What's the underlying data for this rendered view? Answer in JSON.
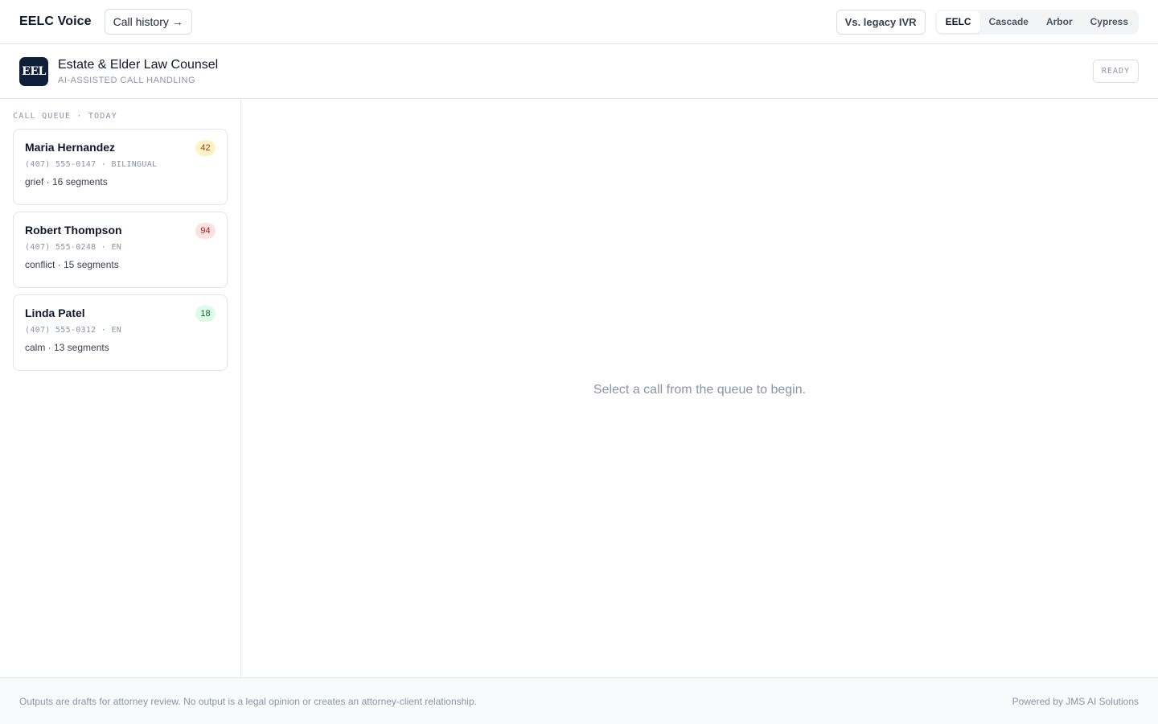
{
  "topbar": {
    "brand": "EELC Voice",
    "history_label": "Call history →",
    "legacy_label": "Vs. legacy IVR",
    "tenants": [
      {
        "label": "EELC",
        "active": true
      },
      {
        "label": "Cascade",
        "active": false
      },
      {
        "label": "Arbor",
        "active": false
      },
      {
        "label": "Cypress",
        "active": false
      }
    ]
  },
  "firm": {
    "logo_text": "EEL",
    "name": "Estate & Elder Law Counsel",
    "subtitle": "AI-ASSISTED CALL HANDLING",
    "status": "READY"
  },
  "queue": {
    "title": "CALL QUEUE · TODAY",
    "calls": [
      {
        "name": "Maria Hernandez",
        "score": "42",
        "score_bg": "#fef3c7",
        "score_color": "#92400e",
        "meta": "(407) 555-0147 · BILINGUAL",
        "foot": "grief · 16 segments"
      },
      {
        "name": "Robert Thompson",
        "score": "94",
        "score_bg": "#fee2e2",
        "score_color": "#991b1b",
        "meta": "(407) 555-0248 · EN",
        "foot": "conflict · 15 segments"
      },
      {
        "name": "Linda Patel",
        "score": "18",
        "score_bg": "#dcfce7",
        "score_color": "#166534",
        "meta": "(407) 555-0312 · EN",
        "foot": "calm · 13 segments"
      }
    ]
  },
  "main": {
    "empty_message": "Select a call from the queue to begin."
  },
  "footer": {
    "disclaimer": "Outputs are drafts for attorney review. No output is a legal opinion or creates an attorney-client relationship.",
    "powered": "Powered by JMS AI Solutions"
  }
}
